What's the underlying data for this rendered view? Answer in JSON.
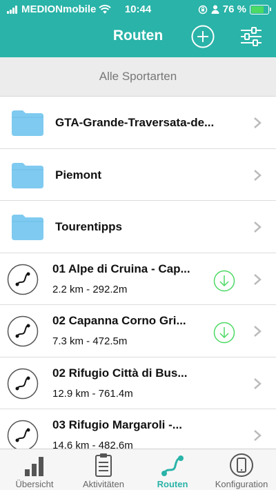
{
  "status_bar": {
    "carrier": "MEDIONmobile",
    "time": "10:44",
    "battery_percent": "76 %",
    "battery_level": 0.76
  },
  "nav": {
    "title": "Routen",
    "add_icon": "plus-circle-icon",
    "filter_icon": "sliders-icon"
  },
  "sport_filter": "Alle Sportarten",
  "folders": [
    {
      "name": "GTA-Grande-Traversata-de..."
    },
    {
      "name": "Piemont"
    },
    {
      "name": "Tourentipps"
    }
  ],
  "routes": [
    {
      "name": "01 Alpe di Cruina - Cap...",
      "meta": "2.2 km - 292.2m",
      "downloaded": true
    },
    {
      "name": "02 Capanna Corno Gri...",
      "meta": "7.3 km - 472.5m",
      "downloaded": true
    },
    {
      "name": "02 Rifugio Città di Bus...",
      "meta": "12.9 km - 761.4m",
      "downloaded": false
    },
    {
      "name": "03 Rifugio Margaroli -...",
      "meta": "14.6 km - 482.6m",
      "downloaded": false
    }
  ],
  "tabs": [
    {
      "label": "Übersicht",
      "icon": "bar-chart-icon",
      "active": false
    },
    {
      "label": "Aktivitäten",
      "icon": "clipboard-icon",
      "active": false
    },
    {
      "label": "Routen",
      "icon": "route-icon",
      "active": true
    },
    {
      "label": "Konfiguration",
      "icon": "phone-icon",
      "active": false
    }
  ],
  "colors": {
    "accent": "#2ab3a8",
    "folder": "#7fcaf0",
    "download": "#4cd964"
  }
}
